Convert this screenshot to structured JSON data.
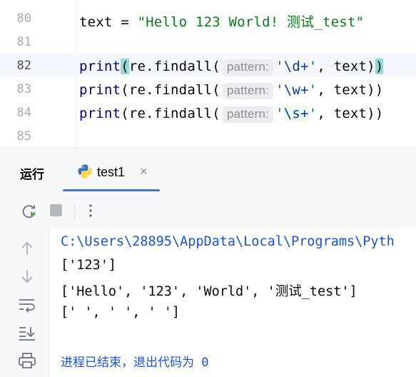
{
  "editor": {
    "lines": [
      {
        "number": "80",
        "parts": [
          {
            "t": "text = ",
            "c": ""
          },
          {
            "t": "\"Hello 123 World! 测试_test\"",
            "c": "kw-str"
          }
        ]
      },
      {
        "number": "81",
        "parts": []
      },
      {
        "number": "82",
        "current": true,
        "parts": [
          {
            "t": "print",
            "c": "kw-fn"
          },
          {
            "t": "(",
            "c": "brace-hl"
          },
          {
            "t": "re.findall(",
            "c": ""
          },
          {
            "hint": "pattern:"
          },
          {
            "t": "'",
            "c": "kw-str"
          },
          {
            "t": "\\d+",
            "c": "esc"
          },
          {
            "t": "'",
            "c": "kw-str"
          },
          {
            "t": ", text)",
            "c": ""
          },
          {
            "t": ")",
            "c": "brace-hl"
          }
        ]
      },
      {
        "number": "83",
        "parts": [
          {
            "t": "print",
            "c": "kw-fn"
          },
          {
            "t": "(re.findall(",
            "c": ""
          },
          {
            "hint": "pattern:"
          },
          {
            "t": "'",
            "c": "kw-str"
          },
          {
            "t": "\\w+",
            "c": "esc"
          },
          {
            "t": "'",
            "c": "kw-str"
          },
          {
            "t": ", text))",
            "c": ""
          }
        ]
      },
      {
        "number": "84",
        "parts": [
          {
            "t": "print",
            "c": "kw-fn"
          },
          {
            "t": "(re.findall(",
            "c": ""
          },
          {
            "hint": "pattern:"
          },
          {
            "t": "'",
            "c": "kw-str"
          },
          {
            "t": "\\s+",
            "c": "esc regex-bg"
          },
          {
            "t": "'",
            "c": "kw-str"
          },
          {
            "t": ", text))",
            "c": ""
          }
        ]
      },
      {
        "number": "85",
        "parts": []
      }
    ]
  },
  "run_panel": {
    "title": "运行",
    "tab": {
      "label": "test1",
      "close": "×",
      "icon": "python-icon"
    },
    "toolbar": {
      "rerun_icon": "rerun-icon",
      "stop_icon": "stop-icon",
      "more_icon": "more-vertical-icon"
    },
    "side": [
      "arrow-up-icon",
      "arrow-down-icon",
      "soft-wrap-icon",
      "scroll-to-end-icon",
      "print-icon"
    ]
  },
  "console": {
    "path": "C:\\Users\\28895\\AppData\\Local\\Programs\\Pyth",
    "outputs": [
      "['123']",
      "['Hello', '123', 'World', '测试_test']",
      "[' ', ' ', ' ']"
    ],
    "exit_message": "进程已结束，退出代码为 0"
  },
  "colors": {
    "accent": "#3574f0",
    "string": "#067d17",
    "path_blue": "#1750eb"
  }
}
